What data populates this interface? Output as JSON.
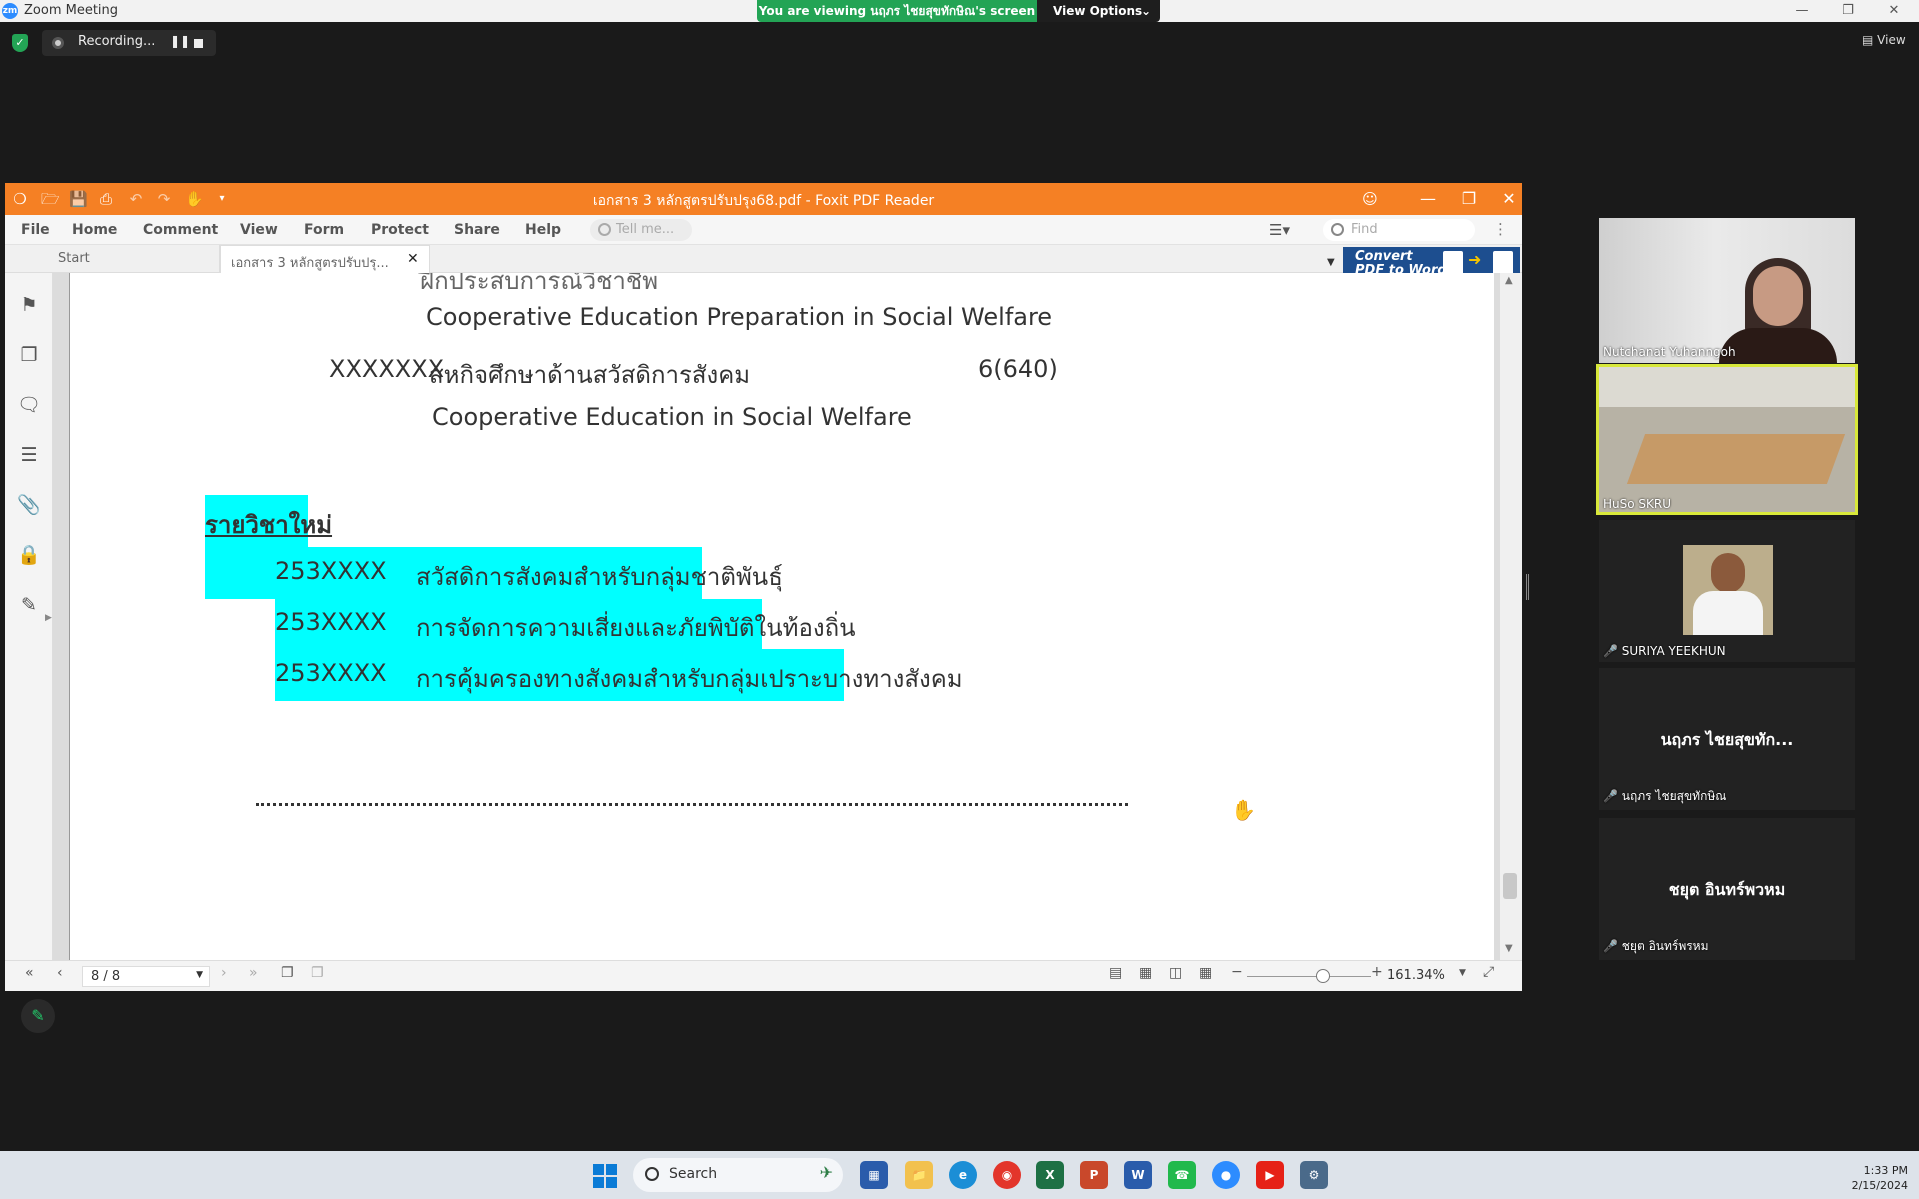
{
  "zoom": {
    "window_title": "Zoom Meeting",
    "viewing_banner": "You are viewing นฤภร  ไชยสุขทักษิณ's screen",
    "view_options": "View Options",
    "recording_label": "Recording...",
    "view_label": "View"
  },
  "foxit": {
    "title": "เอกสาร 3 หลักสูตรปรับปรุง68.pdf - Foxit PDF Reader",
    "menu": [
      "File",
      "Home",
      "Comment",
      "View",
      "Form",
      "Protect",
      "Share",
      "Help"
    ],
    "tellme_placeholder": "Tell me...",
    "find_placeholder": "Find",
    "tabs": {
      "start": "Start",
      "doc": "เอกสาร 3 หลักสูตรปรับปรุ..."
    },
    "convert_ad": {
      "line1": "Convert",
      "line2": "PDF to Word"
    },
    "page_indicator": "8 / 8",
    "zoom_level": "161.34%"
  },
  "document": {
    "line1": "Cooperative Education Preparation in Social Welfare",
    "course_code": "XXXXXXX",
    "course_name_th": "สหกิจศึกษาด้านสวัสดิการสังคม",
    "credits": "6(640)",
    "line3": "Cooperative Education  in Social Welfare",
    "new_courses_heading": "รายวิชาใหม่",
    "new_courses": [
      {
        "code": "253XXXX",
        "name": "สวัสดิการสังคมสำหรับกลุ่มชาติพันธุ์"
      },
      {
        "code": "253XXXX",
        "name": "การจัดการความเสี่ยงและภัยพิบัติในท้องถิ่น"
      },
      {
        "code": "253XXXX",
        "name": "การคุ้มครองทางสังคมสำหรับกลุ่มเปราะบางทางสังคม"
      }
    ]
  },
  "participants": [
    {
      "name": "Nutchanat Yuhanngoh",
      "muted": false
    },
    {
      "name": "HuSo SKRU",
      "muted": false,
      "active": true
    },
    {
      "name": "SURIYA YEEKHUN",
      "muted": true
    },
    {
      "display": "นฤภร  ไชยสุขทัก...",
      "name": "นฤภร  ไชยสุขทักษิณ",
      "muted": true
    },
    {
      "display": "ชยุต อินทร์พวหม",
      "name": "ชยุต อินทร์พรหม",
      "muted": true
    }
  ],
  "taskbar": {
    "search_label": "Search",
    "time": "1:33 PM",
    "date": "2/15/2024"
  },
  "colors": {
    "foxit_orange": "#f58024",
    "highlight": "#00ffff",
    "zoom_green": "#23a455",
    "active_speaker": "#d8e83a"
  }
}
